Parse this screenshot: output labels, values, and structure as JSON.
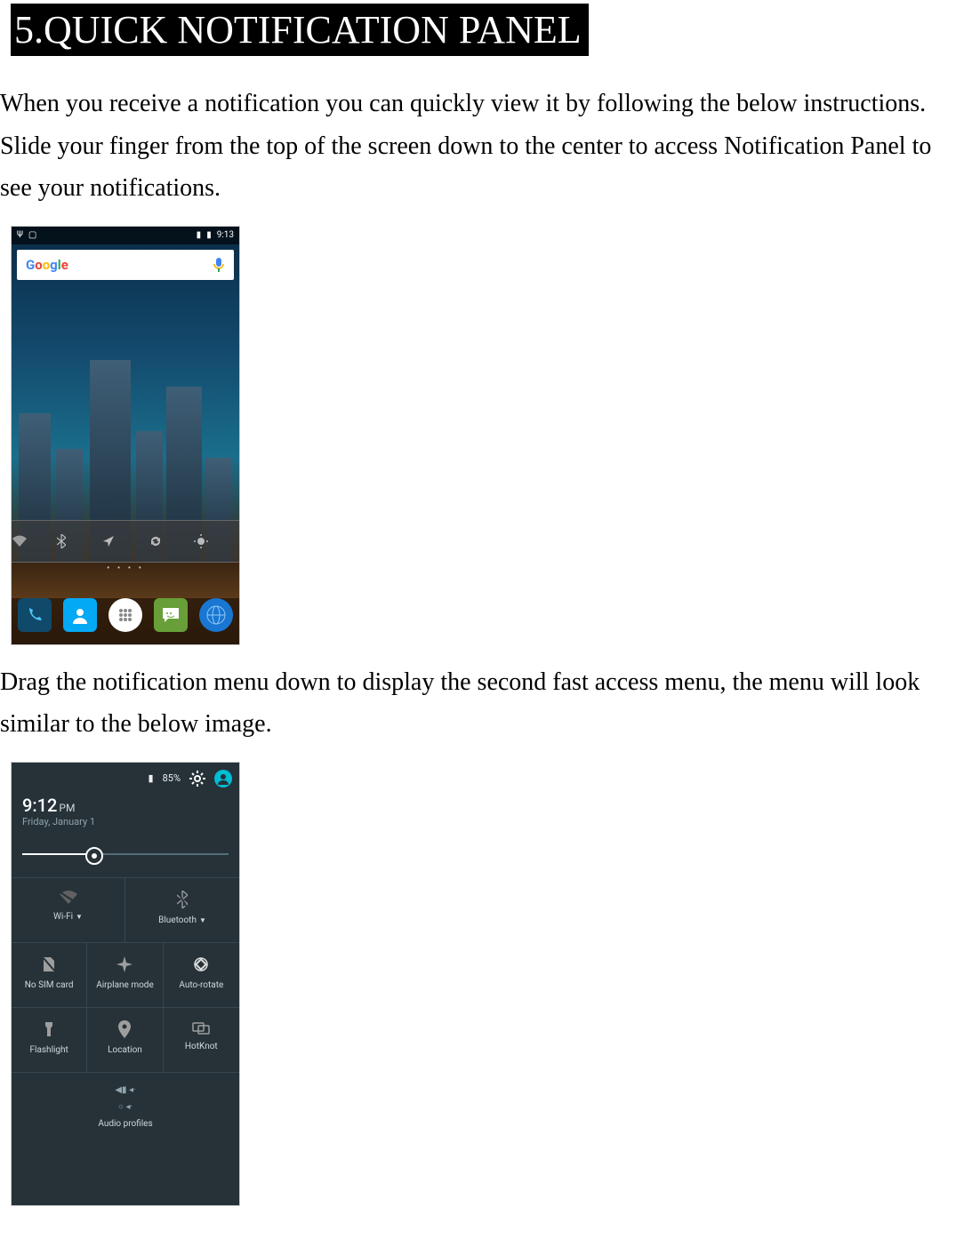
{
  "heading": "5.QUICK NOTIFICATION PANEL",
  "para1": "When you receive a notification you can quickly view it by following the below instructions. Slide your finger from the top of the screen down to the center to access Notification Panel to see your notifications.",
  "para2": "Drag the notification menu down to display the second fast access menu, the menu will look similar to the below image.",
  "shot1": {
    "status_time": "9:13",
    "search_brand": "Google",
    "dock": [
      "Phone",
      "Contacts",
      "Apps",
      "Messages",
      "Browser"
    ]
  },
  "shot2": {
    "battery": "85%",
    "time": "9:12",
    "ampm": "PM",
    "date": "Friday, January 1",
    "tiles": {
      "wifi": "Wi-Fi",
      "bluetooth": "Bluetooth",
      "sim": "No SIM card",
      "airplane": "Airplane mode",
      "rotate": "Auto-rotate",
      "flash": "Flashlight",
      "location": "Location",
      "hotknot": "HotKnot",
      "audio": "Audio profiles"
    }
  }
}
